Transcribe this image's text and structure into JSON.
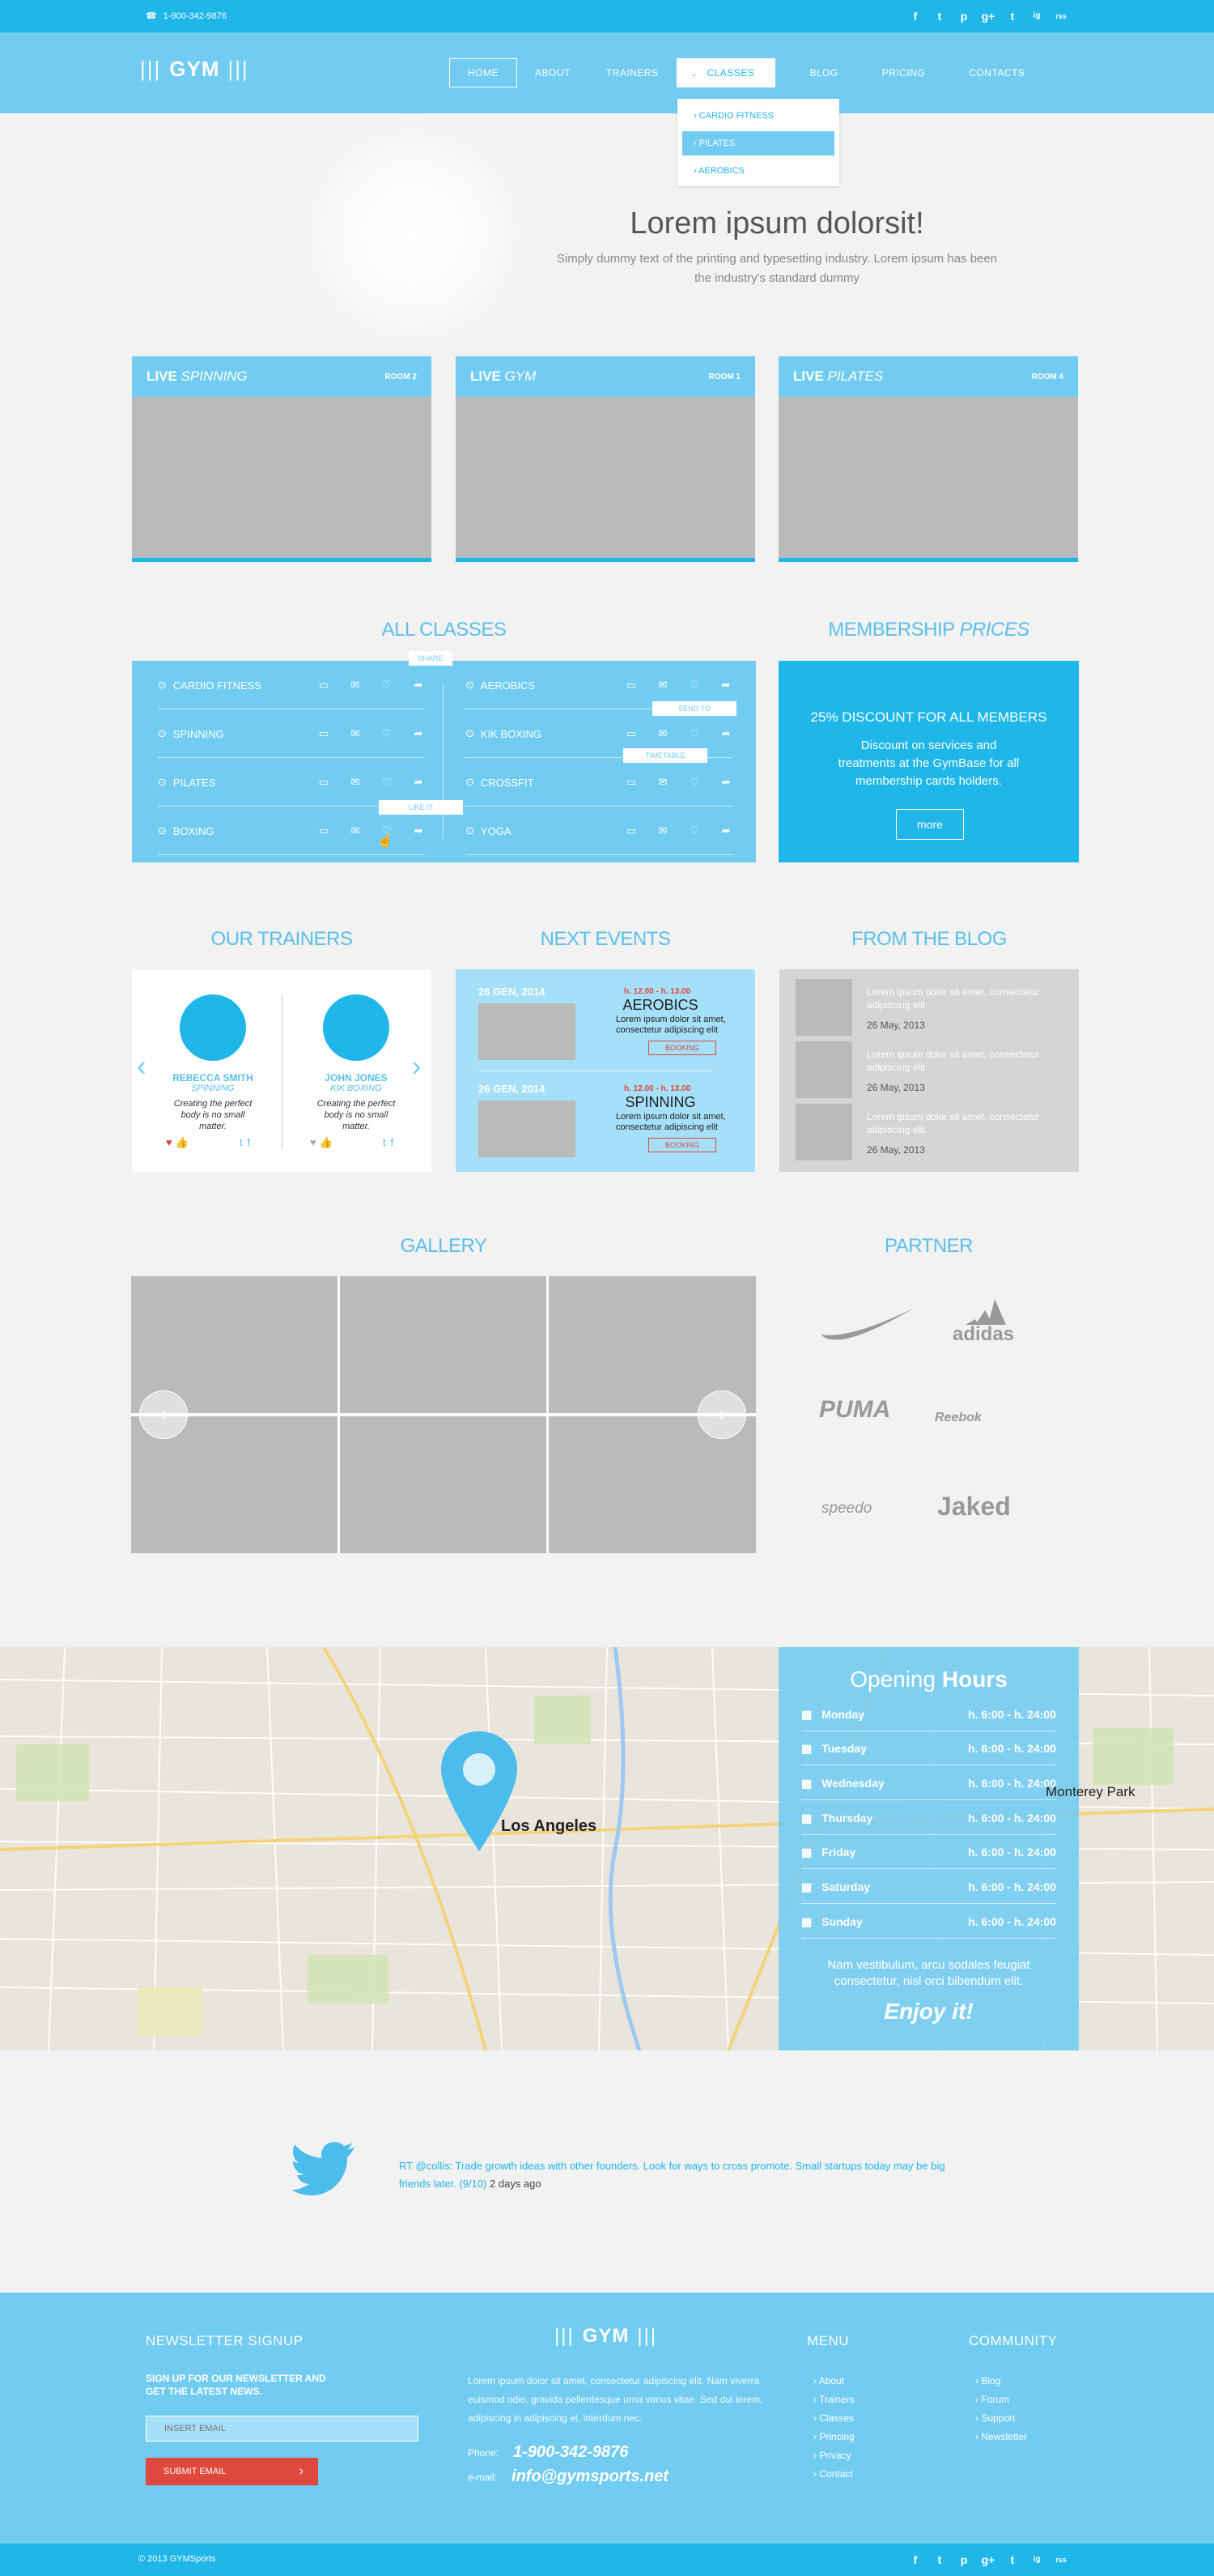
{
  "topbar": {
    "phone": "1-900-342-9876",
    "social": [
      "f",
      "t",
      "p",
      "g+",
      "t",
      "ig",
      "rss"
    ]
  },
  "header": {
    "logo": "GYM"
  },
  "nav": {
    "items": [
      "HOME",
      "ABOUT",
      "TRAINERS",
      "CLASSES",
      "BLOG",
      "PRICING",
      "CONTACTS"
    ]
  },
  "dropdown": {
    "items": [
      "CARDIO FITNESS",
      "PILATES",
      "AEROBICS"
    ]
  },
  "hero": {
    "title": "Lorem ipsum dolorsit!",
    "subtitle": "Simply dummy text of the printing and typesetting industry. Lorem ipsum has been the industry's standard dummy"
  },
  "live": [
    {
      "live": "LIVE",
      "name": "SPINNING",
      "room": "ROOM 2"
    },
    {
      "live": "LIVE",
      "name": "GYM",
      "room": "ROOM 1"
    },
    {
      "live": "LIVE",
      "name": "PILATES",
      "room": "ROOM 4"
    }
  ],
  "classes": {
    "title": "ALL CLASSES",
    "left": [
      "CARDIO FITNESS",
      "SPINNING",
      "PILATES",
      "BOXING"
    ],
    "right": [
      "AEROBICS",
      "KIK BOXING",
      "CROSSFIT",
      "YOGA"
    ],
    "tips": {
      "share": "SHARE",
      "send": "SEND TO",
      "time": "TIMETABLE",
      "like": "LIKE IT"
    }
  },
  "membership": {
    "title": "MEMBERSHIP",
    "title_em": "PRICES",
    "headline": "25% DISCOUNT FOR ALL MEMBERS",
    "text": "Discount on services and treatments at the GymBase for all membership cards holders.",
    "button": "more"
  },
  "trainers": {
    "title": "OUR TRAINERS",
    "items": [
      {
        "name": "REBECCA SMITH",
        "spec": "SPINNING",
        "quote": "Creating the perfect body is no small matter."
      },
      {
        "name": "JOHN JONES",
        "spec": "KIK BOXING",
        "quote": "Creating the perfect body is no small matter."
      }
    ]
  },
  "events": {
    "title": "NEXT EVENTS",
    "items": [
      {
        "date": "26 GEN, 2014",
        "time": "h. 12.00 - h. 13.00",
        "name": "AEROBICS",
        "desc": "Lorem ipsum dolor sit amet, consectetur adipiscing elit",
        "button": "BOOKING"
      },
      {
        "date": "26 GEN, 2014",
        "time": "h. 12.00 - h. 13.00",
        "name": "SPINNING",
        "desc": "Lorem ipsum dolor sit amet, consectetur adipiscing elit",
        "button": "BOOKING"
      }
    ]
  },
  "blog": {
    "title": "FROM THE BLOG",
    "items": [
      {
        "text": "Lorem ipsum dolor sit amet, consectetur adipiscing elit",
        "date": "26 May, 2013"
      },
      {
        "text": "Lorem ipsum dolor sit amet, consectetur adipiscing elit",
        "date": "26 May, 2013"
      },
      {
        "text": "Lorem ipsum dolor sit amet, consectetur adipiscing elit",
        "date": "26 May, 2013"
      }
    ]
  },
  "gallery": {
    "title": "GALLERY"
  },
  "partner": {
    "title": "PARTNER",
    "brands": [
      "adidas",
      "PUMA",
      "Reebok",
      "speedo",
      "Jaked"
    ]
  },
  "map": {
    "city": "Los Angeles",
    "district": "Monterey Park"
  },
  "hours": {
    "title": "Opening",
    "title_strong": "Hours",
    "rows": [
      {
        "day": "Monday",
        "time": "h. 6:00 - h. 24:00"
      },
      {
        "day": "Tuesday",
        "time": "h. 6:00 - h. 24:00"
      },
      {
        "day": "Wednesday",
        "time": "h. 6:00 - h. 24:00"
      },
      {
        "day": "Thursday",
        "time": "h. 6:00 - h. 24:00"
      },
      {
        "day": "Friday",
        "time": "h. 6:00 - h. 24:00"
      },
      {
        "day": "Saturday",
        "time": "h. 6:00 - h. 24:00"
      },
      {
        "day": "Sunday",
        "time": "h. 6:00 - h. 24:00"
      }
    ],
    "note": "Nam vestibulum, arcu sodales feugiat consectetur, nisl orci bibendum elit.",
    "enjoy": "Enjoy it!"
  },
  "tweet": {
    "text": "RT @collis: Trade growth ideas with other founders. Look for ways to cross promote. Small startups today may be big friends later. (9/10)",
    "when": "2 days ago"
  },
  "footer": {
    "newsletter_title": "NEWSLETTER SIGNUP",
    "newsletter_text": "SIGN UP FOR OUR NEWSLETTER AND GET THE LATEST NEWS.",
    "email_placeholder": "INSERT EMAIL",
    "submit": "SUBMIT EMAIL",
    "logo": "GYM",
    "about": "Lorem ipsum dolor sit amet, consectetur adipiscing elit. Nam viverra euismod odio, gravida pellentesque urna varius vitae. Sed dui lorem, adipiscing in adipiscing et, interdum nec.",
    "phone_label": "Phone:",
    "phone": "1-900-342-9876",
    "email_label": "e-mail:",
    "email": "info@gymsports.net",
    "menu_title": "MENU",
    "menu": [
      "About",
      "Trainers",
      "Classes",
      "Princing",
      "Privacy",
      "Contact"
    ],
    "community_title": "COMMUNITY",
    "community": [
      "Blog",
      "Forum",
      "Support",
      "Newsletter"
    ]
  },
  "bottom": {
    "copyright": "© 2013 GYMSports"
  }
}
